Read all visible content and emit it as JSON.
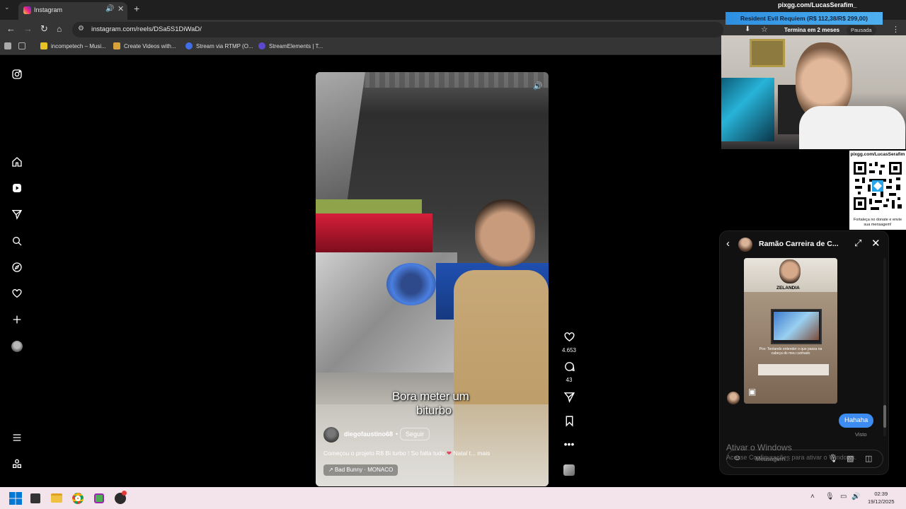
{
  "browser": {
    "tab_title": "Instagram",
    "url": "instagram.com/reels/DSa5S1DiWaD/",
    "bookmarks": [
      {
        "label": "incompetech – Musi..."
      },
      {
        "label": "Create Videos with..."
      },
      {
        "label": "Stream via RTMP (O..."
      },
      {
        "label": "StreamElements | T..."
      }
    ]
  },
  "overlay": {
    "pix_title": "pixgg.com/LucasSerafim_",
    "goal": "Resident Evil Requiem (R$ 112,38/R$ 299,00)",
    "sub_info": "Termina em 2 meses",
    "paused": "Pausada",
    "qr_title": "pixgg.com/LucasSerafim",
    "qr_footer": "Fortaleça no donate e envie sua mensagem!"
  },
  "reel": {
    "subtitle_line1": "Bora meter um",
    "subtitle_line2": "biturbo",
    "username": "diegofaustino68",
    "follow": "Seguir",
    "caption": "Começou o projeto R8 Bi turbo ! So falta tudo",
    "caption_more": "Natal t... mais",
    "music": "Bad Bunny · MONACO",
    "likes": "4.653",
    "comments": "43"
  },
  "chat": {
    "title": "Ramão Carreira de C...",
    "shared_label": "ZELANDIA",
    "shared_caption": "Pov: Tentando entender o que passa na cabeça do meu cunhado",
    "message": "Hahaha",
    "status": "Visto",
    "placeholder": "Mensagem..."
  },
  "watermark": {
    "line1": "Ativar o Windows",
    "line2": "Acesse Configurações para ativar o Windows."
  },
  "taskbar": {
    "time": "02:39",
    "date": "19/12/2025"
  },
  "colors": {
    "accent_blue": "#3c8cf2",
    "taskbar_bg": "#f3e3ea",
    "page_bg": "#000000"
  }
}
